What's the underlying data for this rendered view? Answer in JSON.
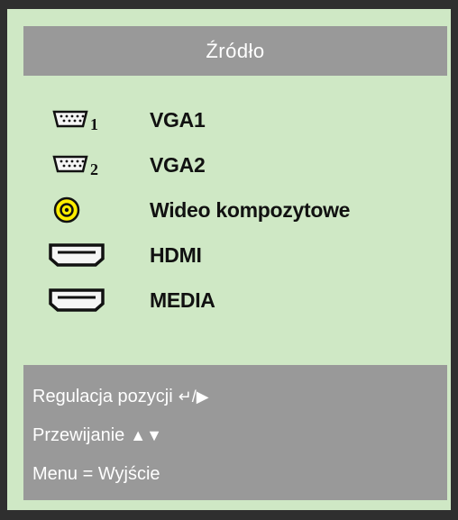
{
  "title": "Źródło",
  "sources": [
    {
      "label": "VGA1",
      "icon": "vga-port-1-icon"
    },
    {
      "label": "VGA2",
      "icon": "vga-port-2-icon"
    },
    {
      "label": "Wideo kompozytowe",
      "icon": "composite-video-icon"
    },
    {
      "label": "HDMI",
      "icon": "hdmi-port-icon"
    },
    {
      "label": "MEDIA",
      "icon": "media-port-icon"
    }
  ],
  "vga_numbers": [
    "1",
    "2"
  ],
  "help": {
    "adjust_label": "Regulacja pozycji",
    "adjust_symbols": "↵/▶",
    "scroll_label": "Przewijanie",
    "scroll_symbols": "▲▼",
    "exit_label": "Menu = Wyjście"
  },
  "colors": {
    "panel_bg": "#cfe8c5",
    "bar_gray": "#999999",
    "frame": "#2f2f2f",
    "composite_yellow": "#ffee00"
  }
}
